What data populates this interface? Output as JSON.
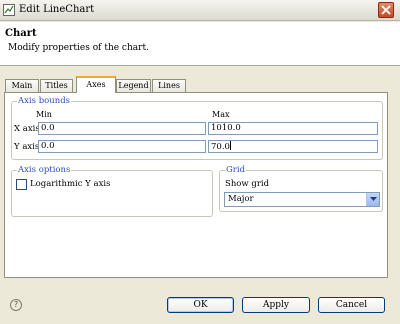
{
  "window": {
    "title": "Edit LineChart"
  },
  "header": {
    "title": "Chart",
    "description": "Modify properties of the chart."
  },
  "tabs": [
    {
      "label": "Main"
    },
    {
      "label": "Titles"
    },
    {
      "label": "Axes"
    },
    {
      "label": "Legend"
    },
    {
      "label": "Lines"
    }
  ],
  "active_tab": "Axes",
  "axis_bounds": {
    "legend": "Axis bounds",
    "min_label": "Min",
    "max_label": "Max",
    "rows": [
      {
        "label": "X axis",
        "min": "0.0",
        "max": "1010.0"
      },
      {
        "label": "Y axis",
        "min": "0.0",
        "max": "70.0"
      }
    ]
  },
  "axis_options": {
    "legend": "Axis options",
    "log_label": "Logarithmic Y axis",
    "log_checked": false
  },
  "grid": {
    "legend": "Grid",
    "show_label": "Show grid",
    "selected": "Major"
  },
  "buttons": {
    "ok": "OK",
    "apply": "Apply",
    "cancel": "Cancel"
  },
  "help_icon": "?",
  "colors": {
    "legend_text": "#2a4fc0",
    "active_tab_accent": "#f6a53b",
    "close_button": "#c54a2a"
  }
}
